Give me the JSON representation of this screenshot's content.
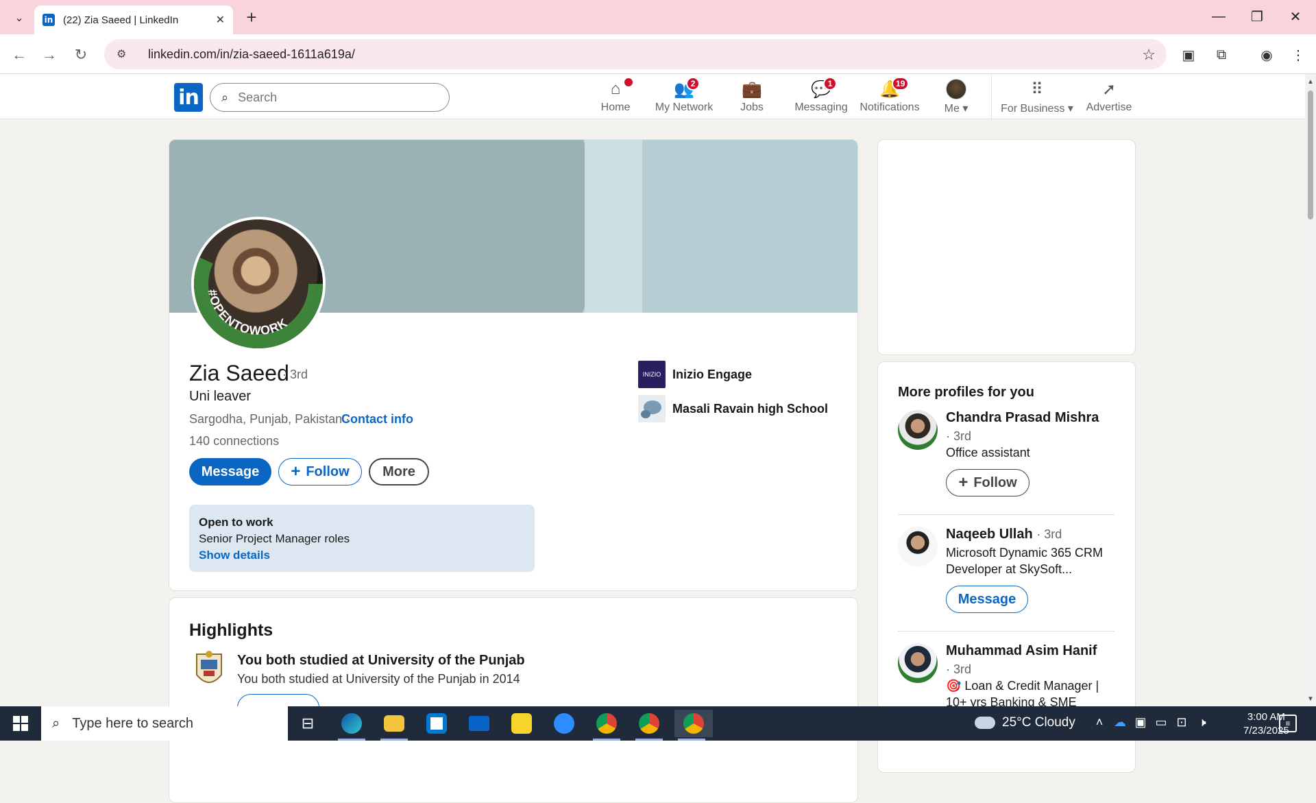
{
  "browser": {
    "tab_title": "(22) Zia Saeed | LinkedIn",
    "url": "linkedin.com/in/zia-saeed-1611a619a/"
  },
  "linkedin_nav": {
    "search_placeholder": "Search",
    "items": [
      {
        "label": "Home",
        "icon": "home-icon",
        "badge": ""
      },
      {
        "label": "My Network",
        "icon": "people-icon",
        "badge": "2"
      },
      {
        "label": "Jobs",
        "icon": "briefcase-icon",
        "badge": ""
      },
      {
        "label": "Messaging",
        "icon": "chat-icon",
        "badge": "1"
      },
      {
        "label": "Notifications",
        "icon": "bell-icon",
        "badge": "19"
      },
      {
        "label": "Me",
        "icon": "avatar",
        "badge": ""
      },
      {
        "label": "For Business",
        "icon": "grid-icon",
        "badge": ""
      },
      {
        "label": "Advertise",
        "icon": "compass-icon",
        "badge": ""
      }
    ]
  },
  "profile": {
    "name": "Zia Saeed",
    "degree": "· 3rd",
    "headline": "Uni leaver",
    "location": "Sargodha, Punjab, Pakistan ·",
    "contact_info": "Contact info",
    "connections_count": "140",
    "connections_label": "connections",
    "avatar_ring_text": "#OPENTOWORK",
    "buttons": {
      "message": "Message",
      "follow": "Follow",
      "more": "More"
    },
    "open_to_work": {
      "title": "Open to work",
      "roles": "Senior Project Manager roles",
      "link": "Show details"
    },
    "experience": [
      {
        "label": "Inizio Engage",
        "logo_text": "INIZIO"
      },
      {
        "label": "Masali Ravain high School",
        "logo_text": ""
      }
    ]
  },
  "highlights": {
    "title": "Highlights",
    "main": "You both studied at University of the Punjab",
    "sub": "You both studied at University of the Punjab in 2014"
  },
  "more_profiles": {
    "title": "More profiles for you",
    "people": [
      {
        "name": "Chandra Prasad Mishra",
        "degree": "· 3rd",
        "headline": "Office assistant",
        "button": "Follow"
      },
      {
        "name": "Naqeeb Ullah",
        "degree": "· 3rd",
        "headline": "Microsoft Dynamic 365 CRM Developer at SkySoft...",
        "button": "Message"
      },
      {
        "name": "Muhammad Asim Hanif",
        "degree": "· 3rd",
        "headline": "🎯 Loan & Credit Manager | 10+ yrs Banking & SME"
      }
    ]
  },
  "taskbar": {
    "search_placeholder": "Type here to search",
    "weather": "25°C  Cloudy",
    "time": "3:00 AM",
    "date": "7/23/2025"
  },
  "colors": {
    "linkedin_blue": "#0a66c2",
    "badge_red": "#cb112d",
    "tab_bar_pink": "#fad4dd"
  }
}
